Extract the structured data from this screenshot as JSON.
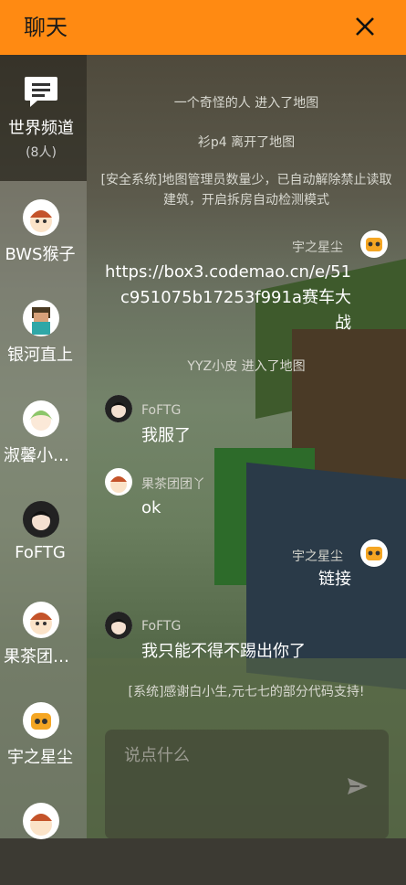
{
  "header": {
    "title": "聊天",
    "close_icon": "close-icon"
  },
  "world": {
    "label": "世界频道",
    "count": "(8人)",
    "icon": "chat-bubble-icon"
  },
  "contacts": [
    {
      "name": "BWS猴子",
      "avatar": "cartoon-girl-avatar"
    },
    {
      "name": "银河直上",
      "avatar": "pixel-character-avatar"
    },
    {
      "name": "淑馨小可爱",
      "avatar": "green-hair-avatar"
    },
    {
      "name": "FoFTG",
      "avatar": "anime-boy-avatar"
    },
    {
      "name": "果茶团团丫",
      "avatar": "cartoon-girl-avatar"
    },
    {
      "name": "宇之星尘",
      "avatar": "robot-avatar"
    },
    {
      "name": "",
      "avatar": "cartoon-girl-avatar"
    }
  ],
  "messages": {
    "sys1": "一个奇怪的人 进入了地图",
    "sys2": "衫p4 离开了地图",
    "sys3": "[安全系统]地图管理员数量少，已自动解除禁止读取建筑，开启拆房自动检测模式",
    "m1": {
      "name": "宇之星尘",
      "line1": "https://box3.codemao.cn/e/51",
      "line2": "c951075b17253f991a赛车大",
      "line3": "战"
    },
    "sys4": "YYZ小皮 进入了地图",
    "m2": {
      "name": "FoFTG",
      "text": "我服了"
    },
    "m3": {
      "name": "果茶团团丫",
      "text": "ok"
    },
    "m4": {
      "name": "宇之星尘",
      "text": "链接"
    },
    "m5": {
      "name": "FoFTG",
      "text": "我只能不得不踢出你了"
    },
    "sys5": "[系统]感谢白小生,元七七的部分代码支持!"
  },
  "input": {
    "placeholder": "说点什么",
    "send_icon": "send-icon"
  },
  "colors": {
    "header": "#ff8a12",
    "text": "#ffffff"
  }
}
